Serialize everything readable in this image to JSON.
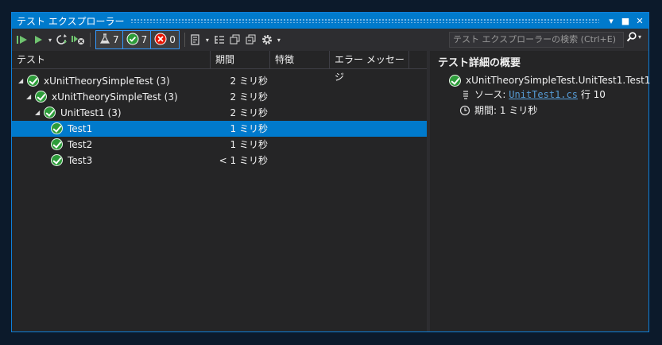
{
  "window": {
    "title": "テスト エクスプローラー",
    "dropdown_glyph": "▾",
    "maximize_glyph": "■",
    "close_glyph": "✕"
  },
  "toolbar": {
    "run_all_icon": "run-all-icon",
    "run_icon": "run-icon",
    "filters": [
      {
        "icon": "flask-icon",
        "count": "7"
      },
      {
        "icon": "passed-icon",
        "count": "7"
      },
      {
        "icon": "failed-icon",
        "count": "0"
      }
    ],
    "search_placeholder": "テスト エクスプローラーの検索 (Ctrl+E)"
  },
  "columns": [
    "テスト",
    "期間",
    "特徴",
    "エラー メッセージ"
  ],
  "tests": [
    {
      "label": "xUnitTheorySimpleTest (3)",
      "duration": "2 ミリ秒",
      "level": 0,
      "expanded": true,
      "selected": false
    },
    {
      "label": "xUnitTheorySimpleTest (3)",
      "duration": "2 ミリ秒",
      "level": 1,
      "expanded": true,
      "selected": false
    },
    {
      "label": "UnitTest1 (3)",
      "duration": "2 ミリ秒",
      "level": 2,
      "expanded": true,
      "selected": false
    },
    {
      "label": "Test1",
      "duration": "1 ミリ秒",
      "level": 3,
      "expanded": false,
      "selected": true
    },
    {
      "label": "Test2",
      "duration": "1 ミリ秒",
      "level": 3,
      "expanded": false,
      "selected": false
    },
    {
      "label": "Test3",
      "duration": "< 1 ミリ秒",
      "level": 3,
      "expanded": false,
      "selected": false
    }
  ],
  "details": {
    "title": "テスト詳細の概要",
    "test_name": "xUnitTheorySimpleTest.UnitTest1.Test1",
    "source_label": "ソース:",
    "source_file": "UnitTest1.cs",
    "source_line": "行 10",
    "duration_label": "期間:",
    "duration_value": "1 ミリ秒"
  },
  "colors": {
    "accent": "#007acc",
    "pass": "#2d9c3a",
    "fail": "#e51400",
    "background": "#252526"
  }
}
